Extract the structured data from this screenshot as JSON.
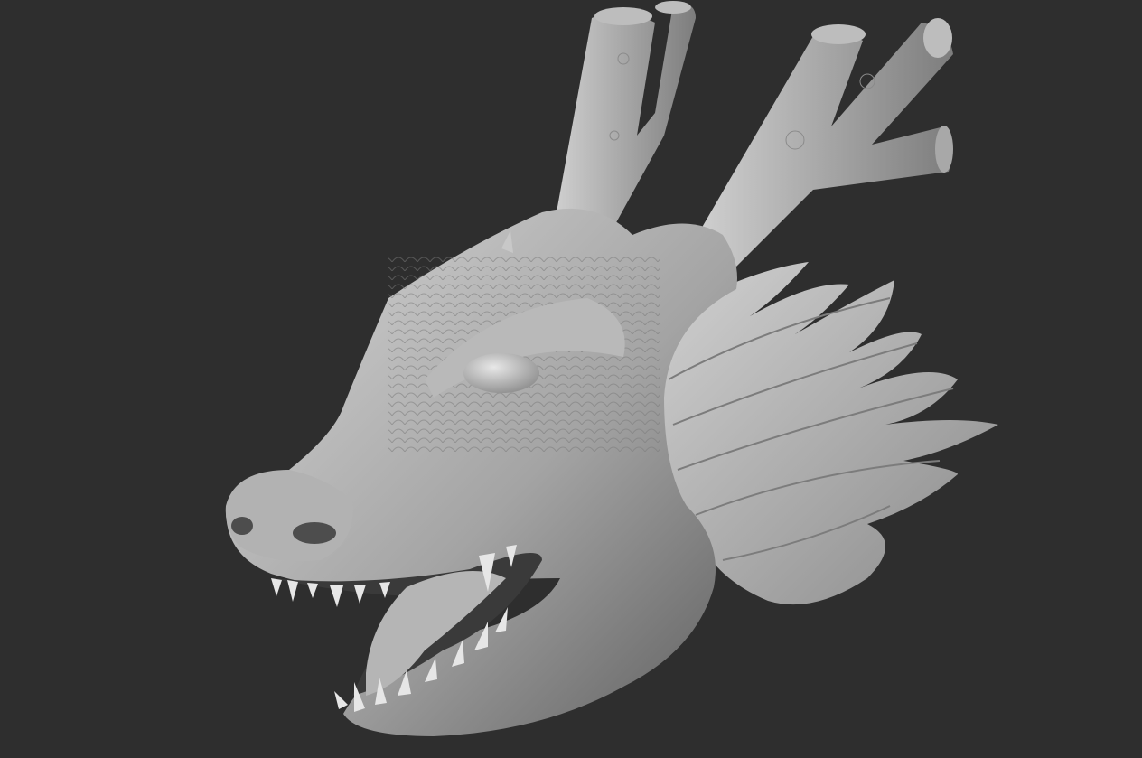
{
  "viewport": {
    "background": "#2e2e2e",
    "subject": "dragon-head-sculpt",
    "material": "matte-gray-clay"
  },
  "colors": {
    "clay_light": "#c8c8c8",
    "clay_mid": "#9a9a9a",
    "clay_dark": "#5a5a5a",
    "mouth_interior": "#3a3a3a",
    "tongue": "#b5b5b5",
    "teeth": "#e6e6e6"
  }
}
